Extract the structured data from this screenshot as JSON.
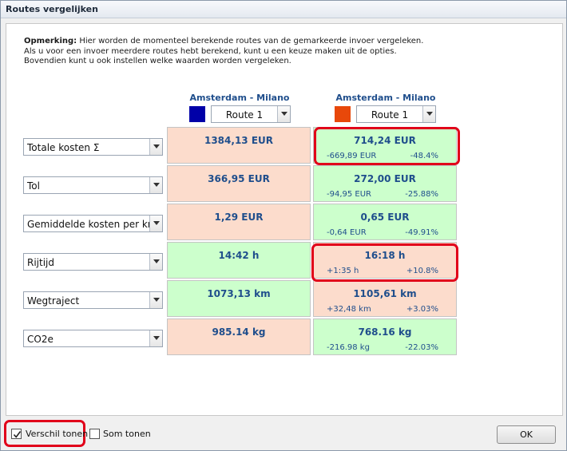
{
  "window": {
    "title": "Routes vergelijken"
  },
  "remark": {
    "label": "Opmerking:",
    "line1": " Hier worden de momenteel berekende routes van de gemarkeerde invoer vergeleken.",
    "line2": "Als u voor een invoer meerdere routes hebt berekend, kunt u een keuze maken uit de opties.",
    "line3": "Bovendien kunt u ook instellen welke waarden worden vergeleken."
  },
  "columns": [
    {
      "title": "Amsterdam - Milano",
      "color": "#0000a8",
      "route": "Route 1"
    },
    {
      "title": "Amsterdam - Milano",
      "color": "#e8480a",
      "route": "Route 1"
    }
  ],
  "rows": [
    {
      "metric": "Totale kosten Σ",
      "a": {
        "value": "1384,13 EUR",
        "tone": "peach"
      },
      "b": {
        "value": "714,24 EUR",
        "diff": "-669,89 EUR",
        "pct": "-48.4%",
        "tone": "green"
      }
    },
    {
      "metric": "Tol",
      "a": {
        "value": "366,95 EUR",
        "tone": "peach"
      },
      "b": {
        "value": "272,00 EUR",
        "diff": "-94,95 EUR",
        "pct": "-25.88%",
        "tone": "green"
      }
    },
    {
      "metric": "Gemiddelde kosten per km",
      "a": {
        "value": "1,29 EUR",
        "tone": "peach"
      },
      "b": {
        "value": "0,65 EUR",
        "diff": "-0,64 EUR",
        "pct": "-49.91%",
        "tone": "green"
      }
    },
    {
      "metric": "Rijtijd",
      "a": {
        "value": "14:42 h",
        "tone": "green"
      },
      "b": {
        "value": "16:18 h",
        "diff": "+1:35 h",
        "pct": "+10.8%",
        "tone": "peach"
      }
    },
    {
      "metric": "Wegtraject",
      "a": {
        "value": "1073,13 km",
        "tone": "green"
      },
      "b": {
        "value": "1105,61 km",
        "diff": "+32,48 km",
        "pct": "+3.03%",
        "tone": "peach"
      }
    },
    {
      "metric": "CO2e",
      "a": {
        "value": "985.14 kg",
        "tone": "peach"
      },
      "b": {
        "value": "768.16 kg",
        "diff": "-216.98 kg",
        "pct": "-22.03%",
        "tone": "green"
      }
    }
  ],
  "options": {
    "show_difference": {
      "label": "Verschil tonen",
      "checked": true
    },
    "show_sum": {
      "label": "Som tonen",
      "checked": false
    }
  },
  "ok_label": "OK"
}
